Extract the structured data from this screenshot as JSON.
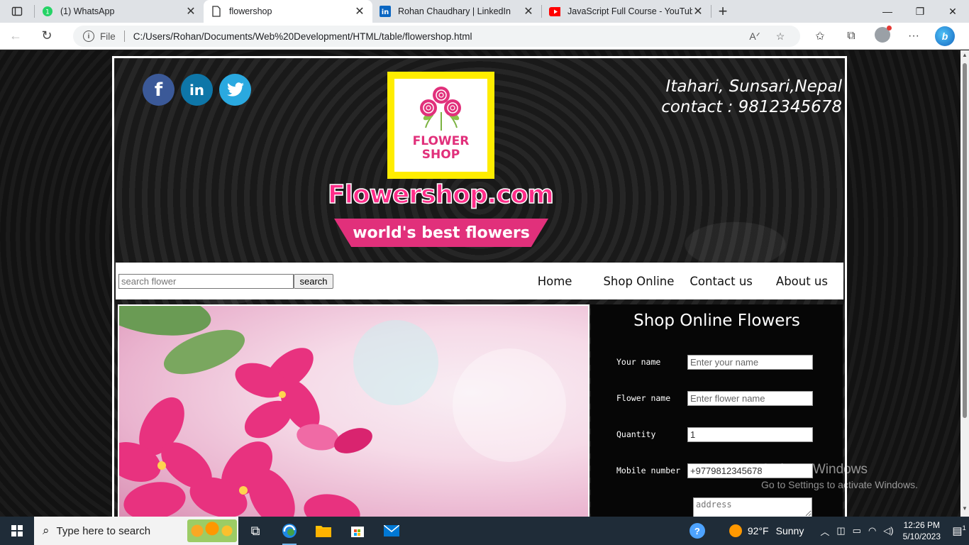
{
  "browser": {
    "tabs": [
      {
        "title": "(1) WhatsApp",
        "icon": "whatsapp-icon",
        "active": false
      },
      {
        "title": "flowershop",
        "icon": "document-icon",
        "active": true
      },
      {
        "title": "Rohan Chaudhary | LinkedIn",
        "icon": "linkedin-icon",
        "active": false
      },
      {
        "title": "JavaScript Full Course - YouTube",
        "icon": "youtube-icon",
        "active": false
      }
    ],
    "file_label": "File",
    "url": "C:/Users/Rohan/Documents/Web%20Development/HTML/table/flowershop.html"
  },
  "page": {
    "location": "Itahari, Sunsari,Nepal",
    "contact": "contact : 9812345678",
    "logo_line1": "FLOWER",
    "logo_line2": "SHOP",
    "site_title": "Flowershop.com",
    "tagline": "world's best flowers",
    "search_placeholder": "search flower",
    "search_button": "search",
    "menu": [
      "Home",
      "Shop Online",
      "Contact us",
      "About us"
    ],
    "order": {
      "title": "Shop Online Flowers",
      "fields": [
        {
          "label": "Your name",
          "placeholder": "Enter your name",
          "value": ""
        },
        {
          "label": "Flower name",
          "placeholder": "Enter flower name",
          "value": ""
        },
        {
          "label": "Quantity",
          "placeholder": "",
          "value": "1"
        },
        {
          "label": "Mobile number",
          "placeholder": "",
          "value": "+9779812345678"
        }
      ],
      "address_placeholder": "address"
    }
  },
  "watermark": {
    "line1": "Activate Windows",
    "line2": "Go to Settings to activate Windows."
  },
  "taskbar": {
    "search_placeholder": "Type here to search",
    "temperature": "92°F",
    "weather": "Sunny",
    "time": "12:26 PM",
    "date": "5/10/2023",
    "notification_count": "1"
  },
  "colors": {
    "brand_pink": "#e1307b",
    "logo_yellow": "#ffed00",
    "facebook": "#3b5998",
    "linkedin": "#0e76a8",
    "twitter": "#2aa9e0"
  }
}
